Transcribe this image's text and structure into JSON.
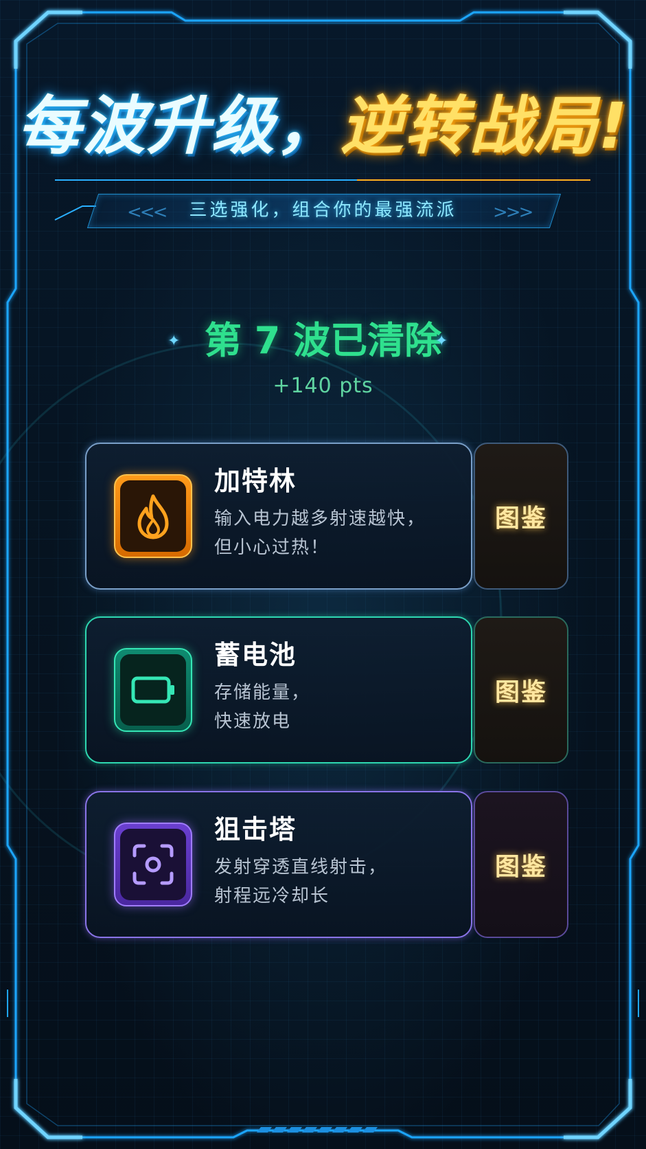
{
  "header": {
    "title_part1": "每波升级，",
    "title_part2": "逆转战局!",
    "subtitle": "三选强化，组合你的最强流派",
    "chevrons_left": "<<<",
    "chevrons_right": ">>>"
  },
  "wave": {
    "title": "第 7 波已清除",
    "points": "+140 pts",
    "sparkle": "✦"
  },
  "upgrades": [
    {
      "name": "加特林",
      "icon": "flame-icon",
      "description_line1": "输入电力越多射速越快，",
      "description_line2": "但小心过热！",
      "codex_label": "图鉴",
      "accent": "#ff9a1a"
    },
    {
      "name": "蓄电池",
      "icon": "battery-icon",
      "description_line1": "存储能量，",
      "description_line2": "快速放电",
      "codex_label": "图鉴",
      "accent": "#35e6b5"
    },
    {
      "name": "狙击塔",
      "icon": "scope-icon",
      "description_line1": "发射穿透直线射击，",
      "description_line2": "射程远冷却长",
      "codex_label": "图鉴",
      "accent": "#a07cff"
    }
  ],
  "colors": {
    "background": "#06111d",
    "frame": "#1fa6ff",
    "wave_green": "#2fe08e",
    "codex_gold": "#ffe7a0"
  }
}
